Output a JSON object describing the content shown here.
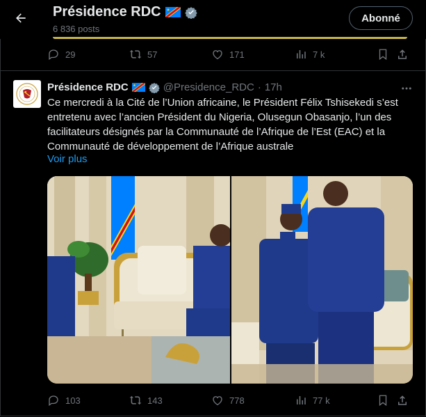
{
  "header": {
    "title": "Présidence RDC",
    "post_count": "6 836 posts",
    "follow_label": "Abonné"
  },
  "prev_actions": {
    "replies": "29",
    "reposts": "57",
    "likes": "171",
    "views": "7 k"
  },
  "tweet": {
    "author_name": "Présidence RDC",
    "handle": "@Presidence_RDC",
    "dot": "·",
    "time": "17h",
    "text": "Ce mercredi à la Cité de l’Union africaine, le Président Félix Tshisekedi s’est entretenu avec l’ancien Président du Nigeria, Olusegun Obasanjo, l’un des facilitateurs désignés par la Communauté de l’Afrique de l’Est (EAC) et la Communauté de développement de l’Afrique australe",
    "see_more": "Voir plus",
    "actions": {
      "replies": "103",
      "reposts": "143",
      "likes": "778",
      "views": "77 k"
    }
  },
  "colors": {
    "background": "#000000",
    "text": "#e7e9ea",
    "muted": "#71767b",
    "link": "#1d9bf0",
    "border": "#2f3336"
  }
}
